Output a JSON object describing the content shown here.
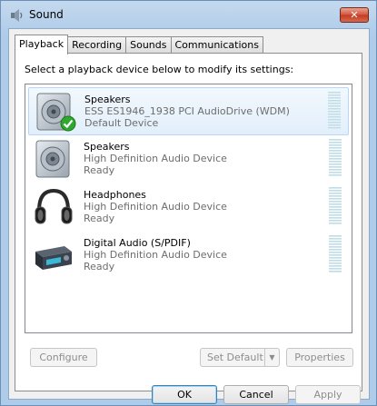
{
  "window": {
    "title": "Sound",
    "close_label": "✕"
  },
  "tabs": [
    {
      "label": "Playback",
      "active": true
    },
    {
      "label": "Recording",
      "active": false
    },
    {
      "label": "Sounds",
      "active": false
    },
    {
      "label": "Communications",
      "active": false
    }
  ],
  "instructions": "Select a playback device below to modify its settings:",
  "devices": [
    {
      "name": "Speakers",
      "description": "ESS ES1946_1938 PCI AudioDrive (WDM)",
      "status": "Default Device",
      "icon": "speaker-icon",
      "selected": true,
      "is_default": true
    },
    {
      "name": "Speakers",
      "description": "High Definition Audio Device",
      "status": "Ready",
      "icon": "speaker-icon",
      "selected": false,
      "is_default": false
    },
    {
      "name": "Headphones",
      "description": "High Definition Audio Device",
      "status": "Ready",
      "icon": "headphones-icon",
      "selected": false,
      "is_default": false
    },
    {
      "name": "Digital Audio (S/PDIF)",
      "description": "High Definition Audio Device",
      "status": "Ready",
      "icon": "digital-audio-receiver-icon",
      "selected": false,
      "is_default": false
    }
  ],
  "buttons": {
    "configure": "Configure",
    "set_default": "Set Default",
    "properties": "Properties",
    "ok": "OK",
    "cancel": "Cancel",
    "apply": "Apply"
  },
  "colors": {
    "selection_border": "#b8d6fb",
    "default_check": "#2fa82f",
    "secondary_text": "#6d6d6d"
  }
}
